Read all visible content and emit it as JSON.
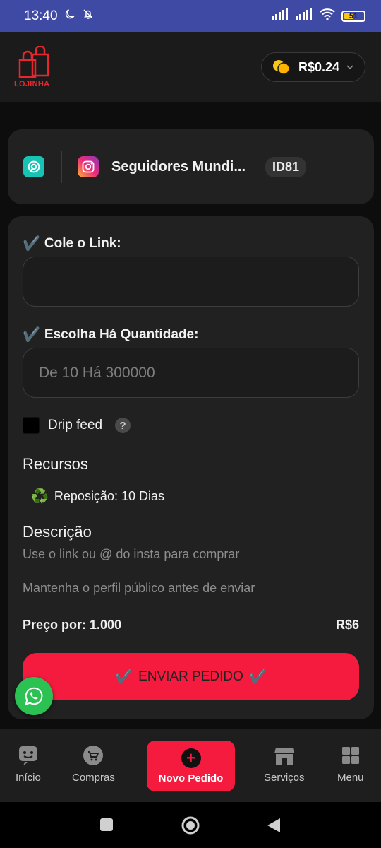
{
  "status_bar": {
    "time": "13:40",
    "battery": "51",
    "battery_level": 0.51
  },
  "header": {
    "logo_text": "LOJINHA",
    "balance": "R$0.24"
  },
  "service": {
    "name": "Seguidores Mundi...",
    "id": "ID81"
  },
  "form": {
    "link_label": "Cole o Link:",
    "link_value": "",
    "qty_label": "Escolha Há Quantidade:",
    "qty_placeholder": "De 10 Há 300000",
    "drip_label": "Drip feed",
    "drip_help": "?",
    "check_glyph": "✔️"
  },
  "resources": {
    "title": "Recursos",
    "icon": "♻️",
    "item": "Reposição: 10 Dias"
  },
  "description": {
    "title": "Descrição",
    "line1": "Use o link ou @ do insta para comprar",
    "line2": "Mantenha o perfil público antes de enviar"
  },
  "price": {
    "label": "Preço por: 1.000",
    "value": "R$6"
  },
  "submit": {
    "label": "ENVIAR PEDIDO"
  },
  "bottom_nav": {
    "items": [
      {
        "label": "Início",
        "icon": "home-icon"
      },
      {
        "label": "Compras",
        "icon": "cart-icon"
      },
      {
        "label": "Novo Pedido",
        "icon": "plus-circle-icon",
        "active": true
      },
      {
        "label": "Serviços",
        "icon": "store-icon"
      },
      {
        "label": "Menu",
        "icon": "grid-icon"
      }
    ]
  },
  "colors": {
    "accent": "#f41b3f",
    "card": "#212121",
    "whatsapp": "#2cc153",
    "status_bar": "#3f4aa5"
  }
}
